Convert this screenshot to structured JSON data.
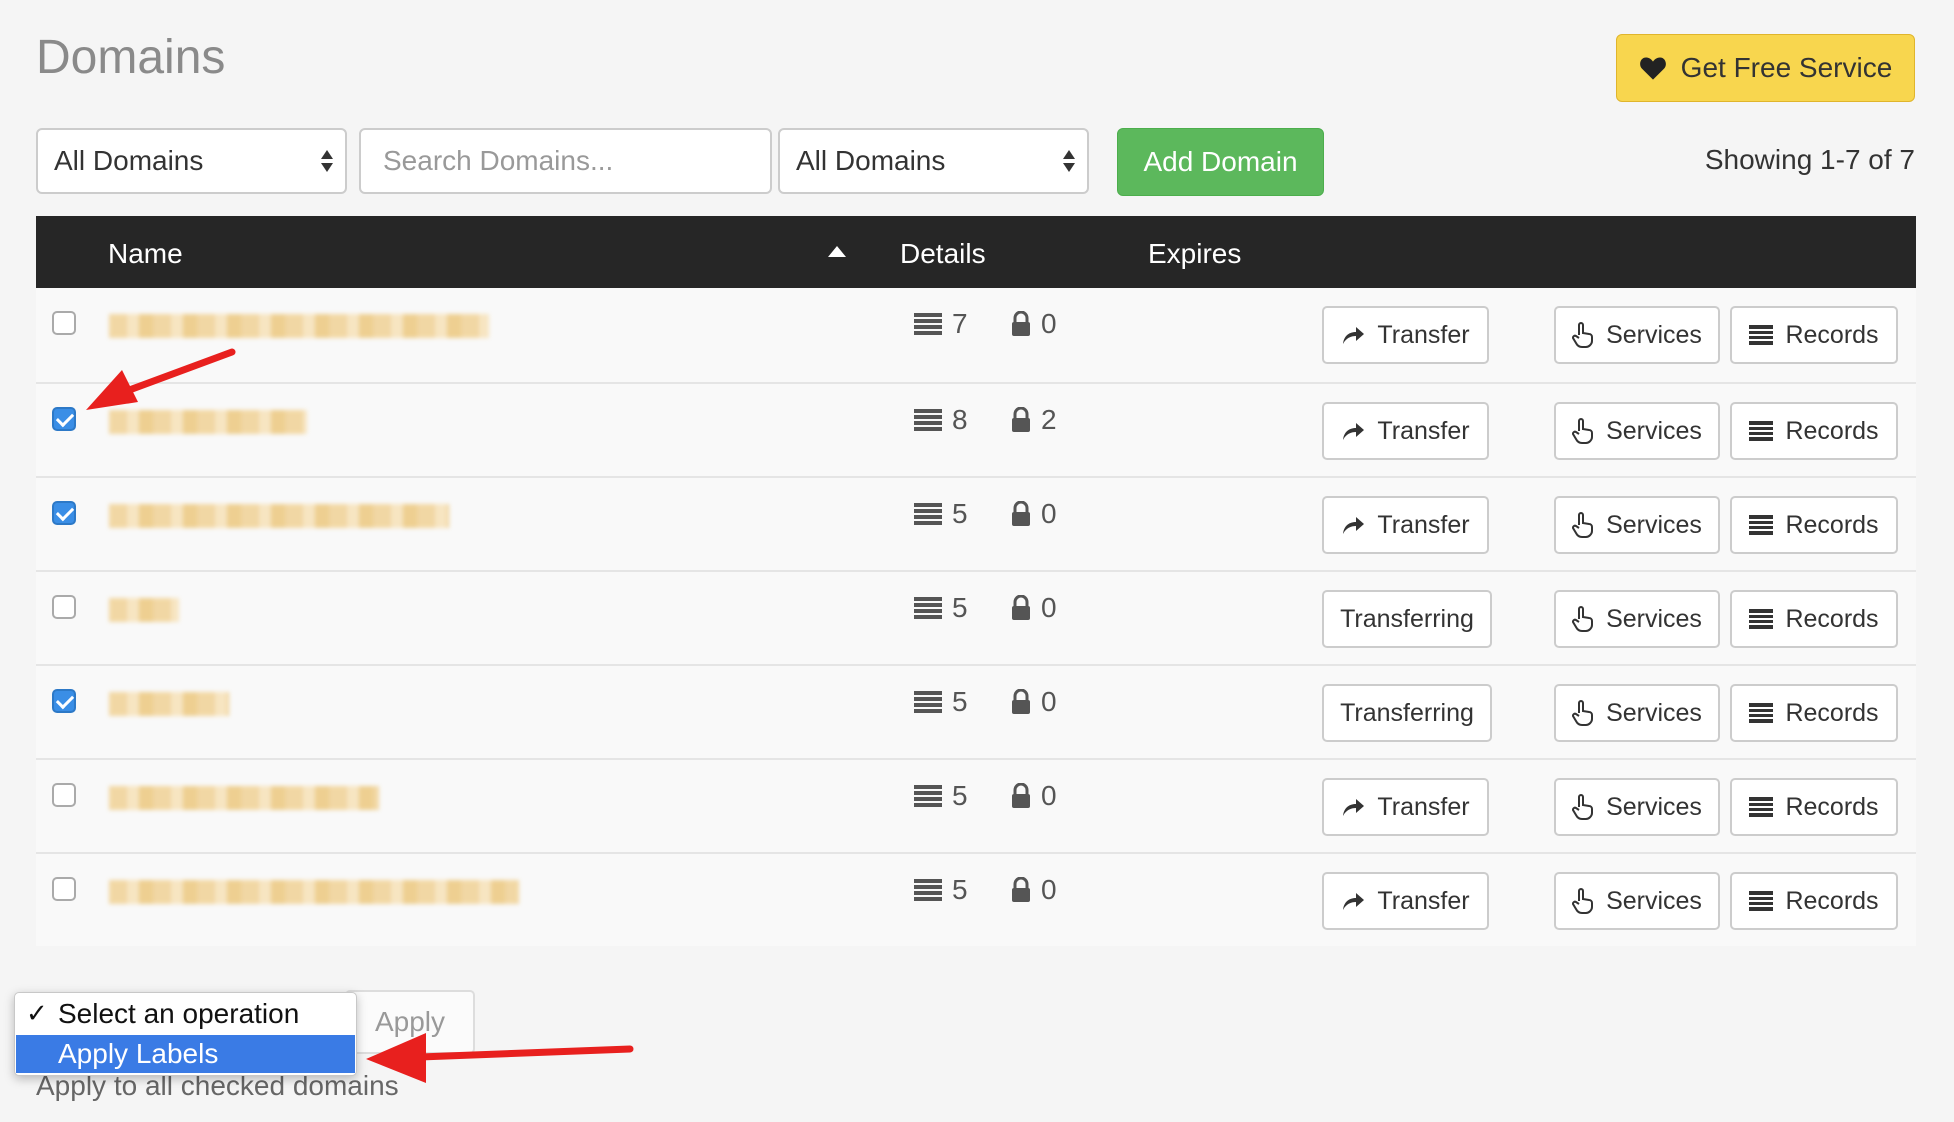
{
  "page": {
    "title": "Domains"
  },
  "header": {
    "get_free_service": "Get Free Service"
  },
  "toolbar": {
    "filter1": "All Domains",
    "search_placeholder": "Search Domains...",
    "filter2": "All Domains",
    "add_domain": "Add Domain",
    "showing": "Showing 1-7 of 7"
  },
  "table": {
    "headers": {
      "name": "Name",
      "details": "Details",
      "expires": "Expires"
    },
    "rows": [
      {
        "checked": false,
        "records": "7",
        "locks": "0",
        "transfer": "Transfer",
        "services": "Services",
        "records_btn": "Records"
      },
      {
        "checked": true,
        "records": "8",
        "locks": "2",
        "transfer": "Transfer",
        "services": "Services",
        "records_btn": "Records"
      },
      {
        "checked": true,
        "records": "5",
        "locks": "0",
        "transfer": "Transfer",
        "services": "Services",
        "records_btn": "Records"
      },
      {
        "checked": false,
        "records": "5",
        "locks": "0",
        "transfer": "Transferring",
        "services": "Services",
        "records_btn": "Records"
      },
      {
        "checked": true,
        "records": "5",
        "locks": "0",
        "transfer": "Transferring",
        "services": "Services",
        "records_btn": "Records"
      },
      {
        "checked": false,
        "records": "5",
        "locks": "0",
        "transfer": "Transfer",
        "services": "Services",
        "records_btn": "Records"
      },
      {
        "checked": false,
        "records": "5",
        "locks": "0",
        "transfer": "Transfer",
        "services": "Services",
        "records_btn": "Records"
      }
    ]
  },
  "bulk": {
    "apply": "Apply",
    "note": "Apply to all checked domains",
    "options": [
      "Select an operation",
      "Apply Labels"
    ],
    "check_mark": "✓"
  },
  "colors": {
    "accent_green": "#5cb85c",
    "accent_yellow": "#f8d64e",
    "header_dark": "#262626",
    "checkbox_blue": "#3a8ee6",
    "annotation_red": "#e8201e"
  }
}
